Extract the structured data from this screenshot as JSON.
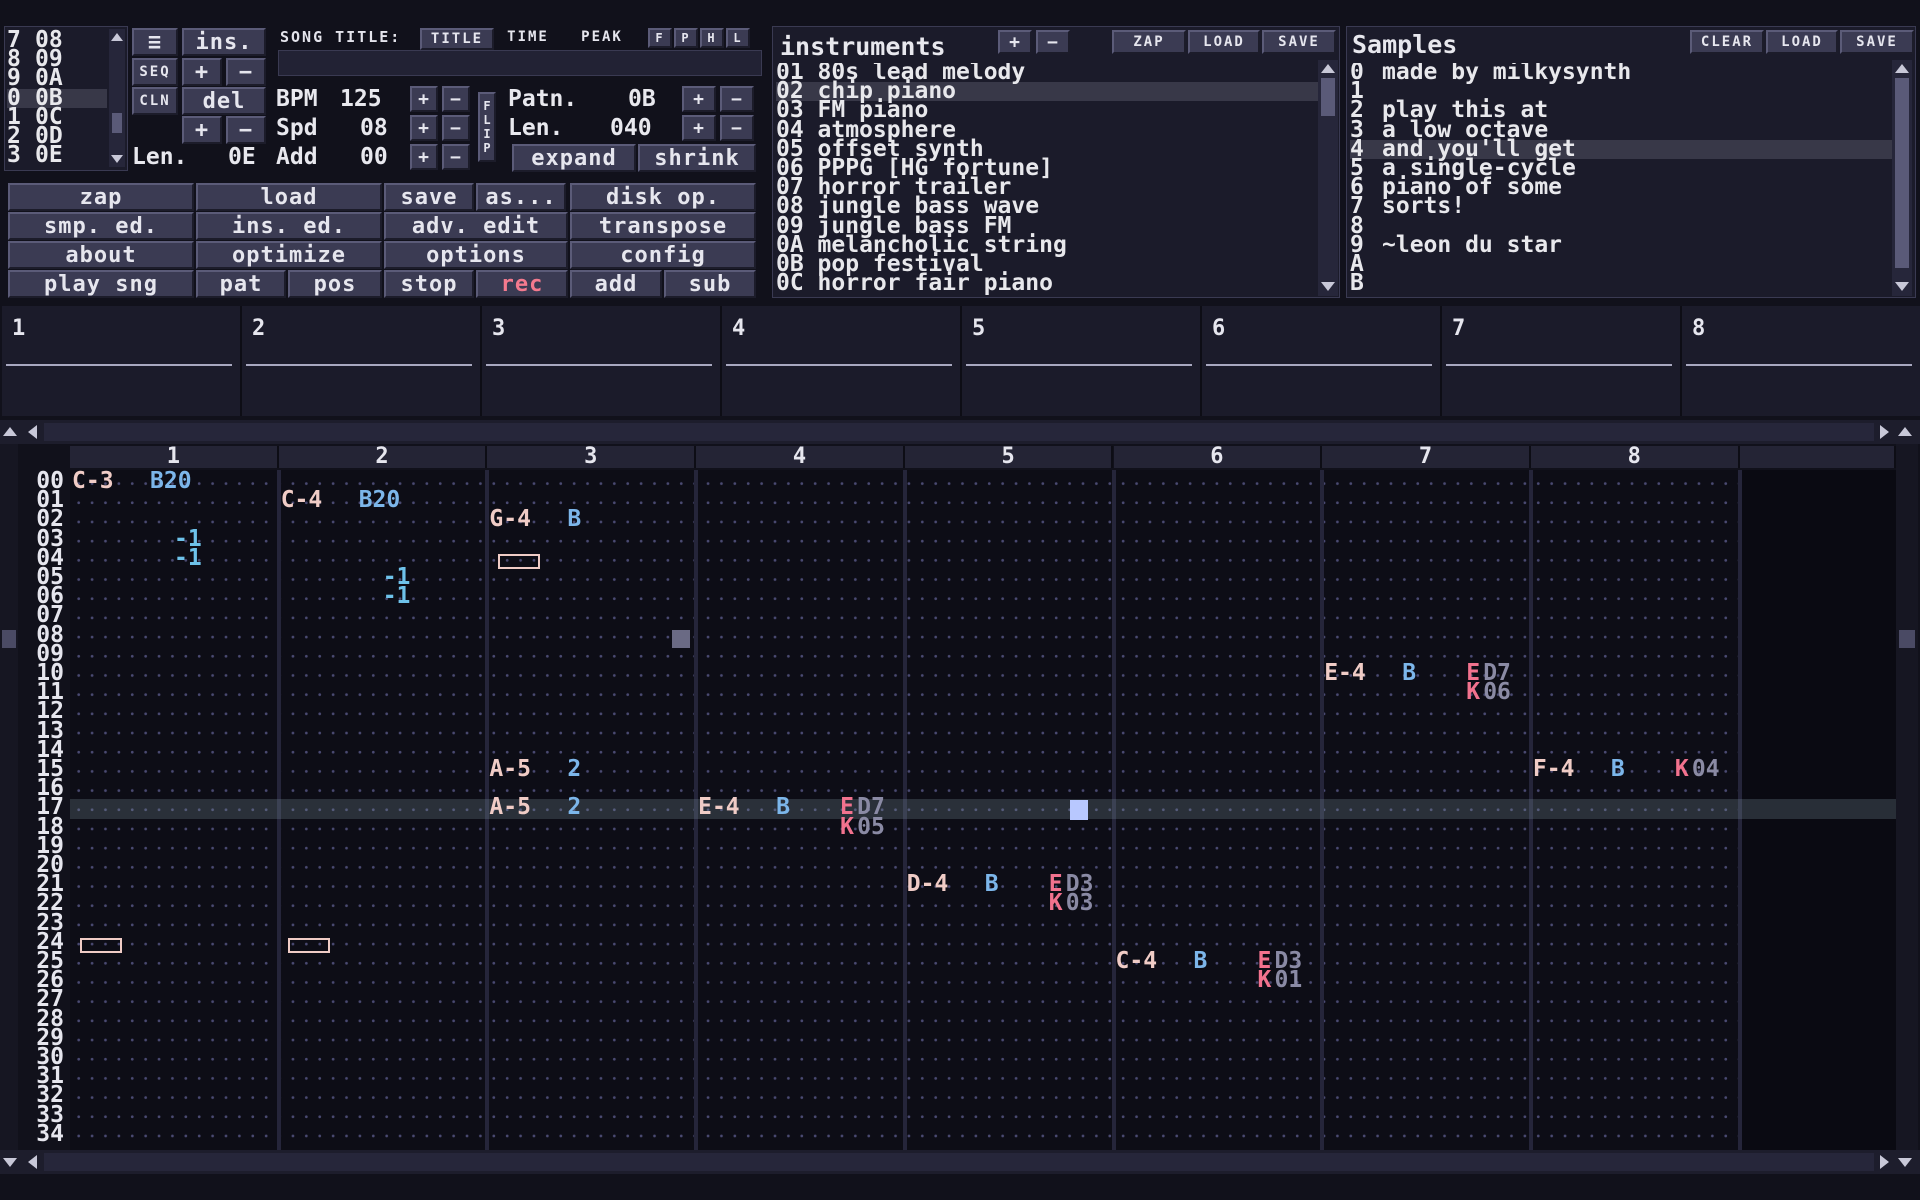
{
  "app": {
    "song_title_label": "SONG TITLE:",
    "title_btn": "TITLE",
    "time_btn": "TIME",
    "peak_btn": "PEAK",
    "mini_btns": [
      "F",
      "P",
      "H",
      "L"
    ]
  },
  "orderlist": {
    "rows": [
      {
        "pos": "7",
        "pat": "08"
      },
      {
        "pos": "8",
        "pat": "09"
      },
      {
        "pos": "9",
        "pat": "0A"
      },
      {
        "pos": "0",
        "pat": "0B"
      },
      {
        "pos": "1",
        "pat": "0C"
      },
      {
        "pos": "2",
        "pat": "0D"
      },
      {
        "pos": "3",
        "pat": "0E"
      }
    ],
    "len_label": "Len.",
    "len_value": "0E"
  },
  "seqbtns": {
    "menu": "≡",
    "ins": "ins.",
    "seq": "SEQ",
    "cln": "CLN",
    "del": "del",
    "plus": "+",
    "minus": "−"
  },
  "song": {
    "bpm_label": "BPM",
    "bpm_value": "125",
    "spd_label": "Spd",
    "spd_value": "08",
    "add_label": "Add",
    "add_value": "00",
    "flip_label": "FLIP",
    "patn_label": "Patn.",
    "patn_value": "0B",
    "len_label": "Len.",
    "len_value": "040",
    "expand": "expand",
    "shrink": "shrink"
  },
  "mainbtns": [
    [
      "zap",
      "load",
      "save",
      "as...",
      "disk op."
    ],
    [
      "smp. ed.",
      "ins. ed.",
      "adv. edit",
      "transpose"
    ],
    [
      "about",
      "optimize",
      "options",
      "config"
    ],
    [
      "play sng",
      "pat",
      "pos",
      "stop",
      "rec",
      "add",
      "sub"
    ]
  ],
  "instruments": {
    "title": "instruments",
    "zap": "ZAP",
    "load": "LOAD",
    "save": "SAVE",
    "items": [
      "01 80s lead melody",
      "02 chip piano",
      "03 FM piano",
      "04 atmosphere",
      "05 offset synth",
      "06 PPPG [HG fortune]",
      "07 horror trailer",
      "08 jungle bass wave",
      "09 jungle bass FM",
      "0A melancholic string",
      "0B pop festival",
      "0C horror fair piano"
    ],
    "selected": 1
  },
  "samples": {
    "title": "Samples",
    "clear": "CLEAR",
    "load": "LOAD",
    "save": "SAVE",
    "nums": [
      "0",
      "1",
      "2",
      "3",
      "4",
      "5",
      "6",
      "7",
      "8",
      "9",
      "A",
      "B"
    ],
    "texts": [
      "made by milkysynth",
      "",
      "play this at",
      "a low octave",
      "and you'll get",
      "a single-cycle",
      "piano of some",
      "sorts!",
      "",
      "~leon du star",
      "",
      ""
    ],
    "selected": 4
  },
  "scopes": [
    "1",
    "2",
    "3",
    "4",
    "5",
    "6",
    "7",
    "8"
  ],
  "pattern": {
    "channels": [
      "1",
      "2",
      "3",
      "4",
      "5",
      "6",
      "7",
      "8"
    ],
    "rows": [
      "00",
      "01",
      "02",
      "03",
      "04",
      "05",
      "06",
      "07",
      "08",
      "09",
      "10",
      "11",
      "12",
      "13",
      "14",
      "15",
      "16",
      "17",
      "18",
      "19",
      "20",
      "21",
      "22",
      "23",
      "24",
      "25",
      "26",
      "27",
      "28",
      "29",
      "30",
      "31",
      "32",
      "33",
      "34"
    ],
    "cursor_row": 17,
    "notes": {
      "c1r00": {
        "n": "C-3",
        "i": "B20"
      },
      "c1r03": {
        "v": "-1"
      },
      "c1r04": {
        "v": "-1"
      },
      "c2r01": {
        "n": "C-4",
        "i": "B20"
      },
      "c2r05": {
        "v": "-1"
      },
      "c2r06": {
        "v": "-1"
      },
      "c3r02": {
        "n": "G-4",
        "i": "B"
      },
      "c3r15": {
        "n": "A-5",
        "i": "2"
      },
      "c3r17": {
        "n": "A-5",
        "i": "2"
      },
      "c4r17": {
        "n": "E-4",
        "i": "B",
        "e": "E",
        "p": "D7"
      },
      "c4r18": {
        "e": "K",
        "p": "05"
      },
      "c5r21": {
        "n": "D-4",
        "i": "B",
        "e": "E",
        "p": "D3"
      },
      "c5r22": {
        "e": "K",
        "p": "03"
      },
      "c6r25": {
        "n": "C-4",
        "i": "B",
        "e": "E",
        "p": "D3"
      },
      "c6r26": {
        "e": "K",
        "p": "01"
      },
      "c7r10": {
        "n": "E-4",
        "i": "B",
        "e": "E",
        "p": "D7"
      },
      "c7r11": {
        "e": "K",
        "p": "06"
      },
      "c8r15": {
        "n": "F-4",
        "i": "B",
        "e": "K",
        "p": "04"
      }
    }
  },
  "colors": {
    "bg": "#11111b",
    "panel": "#1b1b2a",
    "button": "#3b3b53",
    "note": "#f0ccc6",
    "instrument": "#7cb6ea",
    "effect": "#f2728e",
    "rec": "#f47a8e"
  }
}
